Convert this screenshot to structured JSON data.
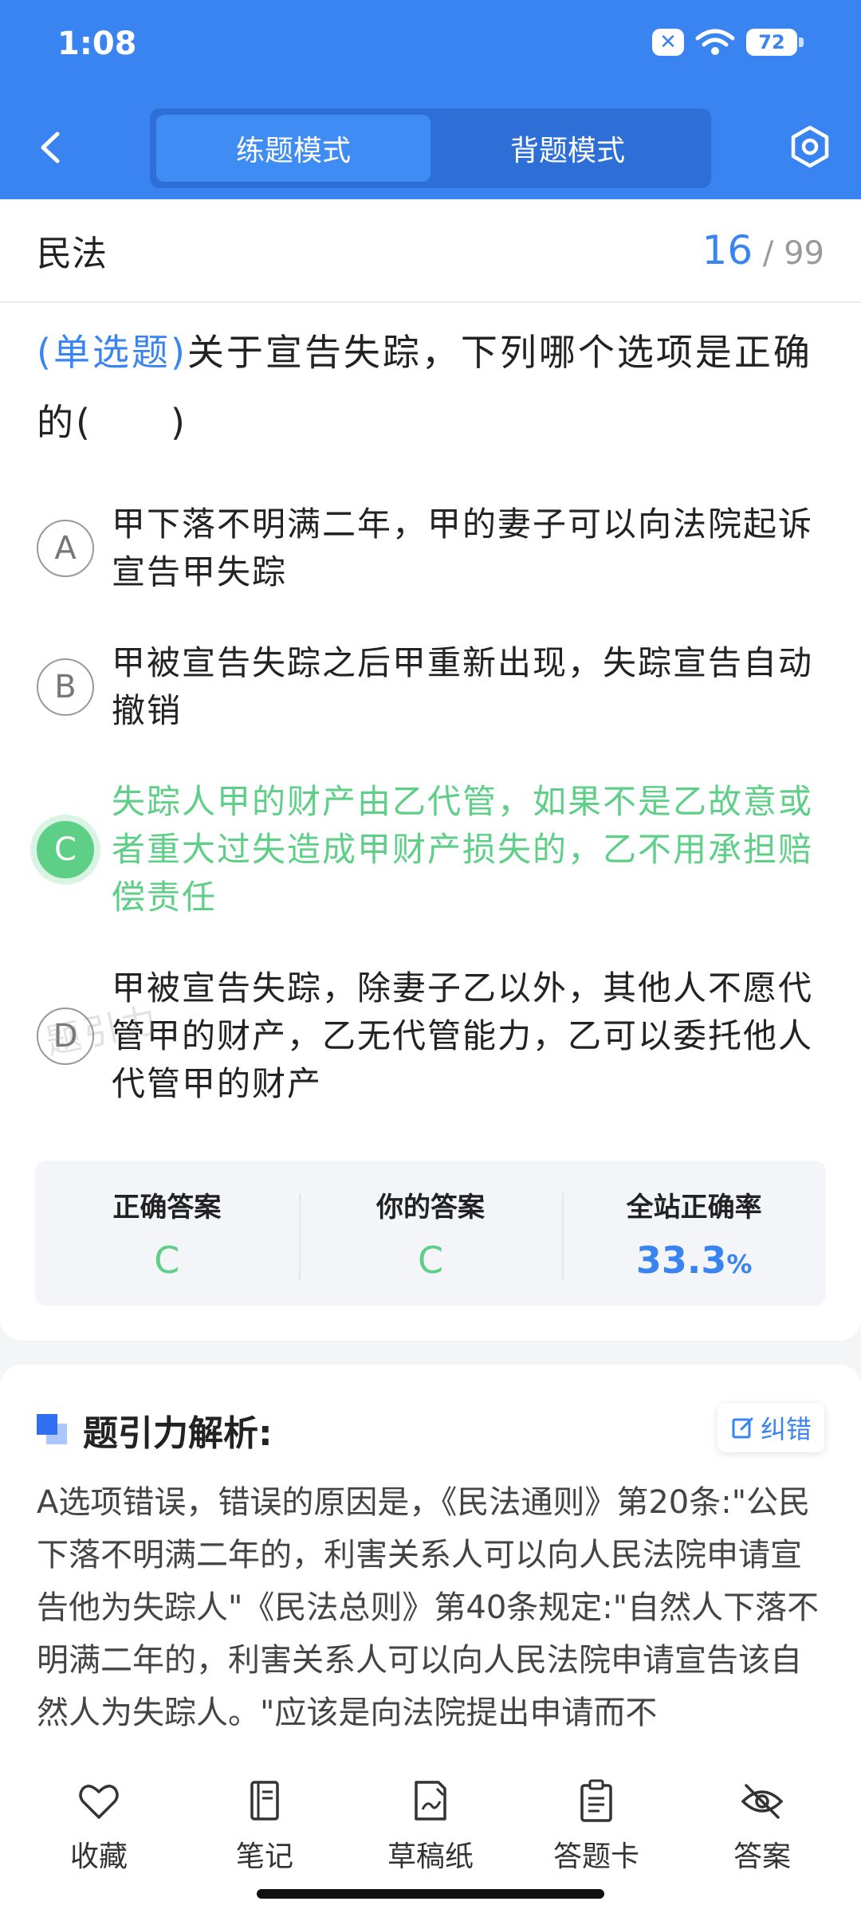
{
  "status_bar": {
    "time": "1:08",
    "battery": "72"
  },
  "header": {
    "modes": [
      "练题模式",
      "背题模式"
    ],
    "active_mode": "练题模式"
  },
  "question_meta": {
    "subject": "民法",
    "current": "16",
    "separator": "/",
    "total": "99"
  },
  "question": {
    "type": "(单选题)",
    "text": "关于宣告失踪，下列哪个选项是正确的(　　)"
  },
  "options": [
    {
      "letter": "A",
      "text": "甲下落不明满二年，甲的妻子可以向法院起诉宣告甲失踪"
    },
    {
      "letter": "B",
      "text": "甲被宣告失踪之后甲重新出现，失踪宣告自动撤销"
    },
    {
      "letter": "C",
      "text": "失踪人甲的财产由乙代管，如果不是乙故意或者重大过失造成甲财产损失的，乙不用承担赔偿责任"
    },
    {
      "letter": "D",
      "text": "甲被宣告失踪，除妻子乙以外，其他人不愿代管甲的财产，乙无代管能力，乙可以委托他人代管甲的财产"
    }
  ],
  "watermark": "题引力",
  "result": {
    "correct_label": "正确答案",
    "correct_value": "C",
    "yours_label": "你的答案",
    "yours_value": "C",
    "rate_label": "全站正确率",
    "rate_value": "33.3",
    "rate_unit": "%"
  },
  "analysis": {
    "title": "题引力解析:",
    "report_label": "纠错",
    "text": "A选项错误，错误的原因是，《民法通则》第20条:\"公民下落不明满二年的，利害关系人可以向人民法院申请宣告他为失踪人\"《民法总则》第40条规定:\"自然人下落不明满二年的，利害关系人可以向人民法院申请宣告该自然人为失踪人。\"应该是向法院提出申请而不"
  },
  "bottom_nav": [
    {
      "label": "收藏",
      "icon": "heart-icon"
    },
    {
      "label": "笔记",
      "icon": "notebook-icon"
    },
    {
      "label": "草稿纸",
      "icon": "draft-paper-icon"
    },
    {
      "label": "答题卡",
      "icon": "answer-card-icon"
    },
    {
      "label": "答案",
      "icon": "eye-off-icon"
    }
  ],
  "colors": {
    "primary": "#3a84f2",
    "correct": "#5ecf86"
  }
}
